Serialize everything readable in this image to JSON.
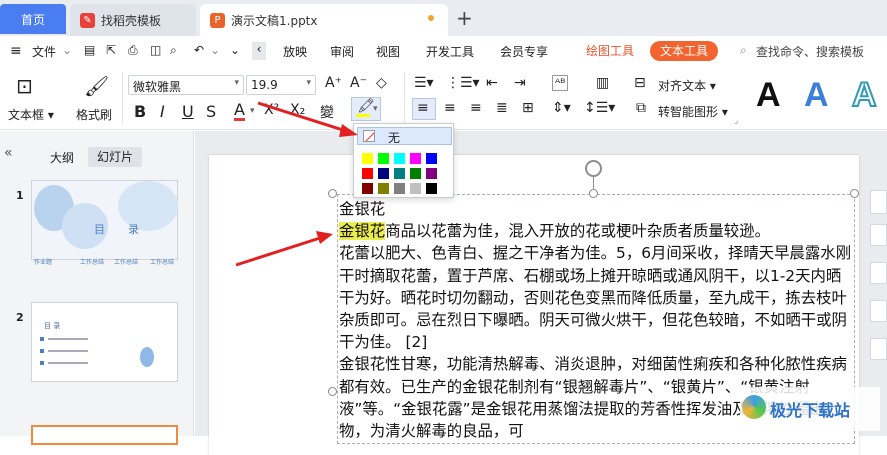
{
  "tabs": {
    "home": "首页",
    "template": "找稻壳模板",
    "document": "演示文稿1.pptx",
    "new_tab": "+"
  },
  "menu": {
    "file": "文件",
    "items": [
      "放映",
      "审阅",
      "视图",
      "开发工具",
      "会员专享"
    ],
    "drawing_tools": "绘图工具",
    "text_tools": "文本工具",
    "search_placeholder": "查找命令、搜索模板"
  },
  "ribbon": {
    "textbox": "文本框",
    "format_painter": "格式刷",
    "font_name": "微软雅黑",
    "font_size": "19.9",
    "align_text": "对齐文本",
    "smart_shape": "转智能图形",
    "style_samples": [
      "A",
      "A",
      "A"
    ]
  },
  "left_panel": {
    "outline_tab": "大纲",
    "slides_tab": "幻灯片",
    "slide1_number": "1",
    "slide2_number": "2",
    "slide1_title_left": "目",
    "slide1_title_right": "录",
    "slide1_labels": [
      "作业题",
      "工作总结",
      "工作总结",
      "工作总结"
    ],
    "slide2_title": "目  录"
  },
  "highlight_popup": {
    "none_label": "无",
    "colors": [
      "#ffff00",
      "#00ff00",
      "#00ffff",
      "#ff00ff",
      "#0000ff",
      "#ff0000",
      "#000080",
      "#008080",
      "#008000",
      "#800080",
      "#800000",
      "#808000",
      "#808080",
      "#c0c0c0",
      "#000000"
    ]
  },
  "slide": {
    "title": "金银花",
    "highlighted": "金银花",
    "body_line1_rest": "商品以花蕾为佳，混入开放的花或梗叶杂质者质量较逊。",
    "body": "花蕾以肥大、色青白、握之干净者为佳。5，6月间采收，择晴天早晨露水刚干时摘取花蕾，置于芦席、石棚或场上摊开晾晒或通风阴干，以1-2天内晒干为好。晒花时切勿翻动，否则花色变黑而降低质量，至九成干，拣去枝叶杂质即可。忌在烈日下曝晒。阴天可微火烘干，但花色较暗，不如晒干或阴干为佳。 [2]\n金银花性甘寒，功能清热解毒、消炎退肿，对细菌性痢疾和各种化脓性疾病都有效。已生产的金银花制剂有“银翘解毒片”、“银黄片”、“银黄注射液”等。“金银花露”是金银花用蒸馏法提取的芳香性挥发油及水溶性溜出物，为清火解毒的良品，可"
  },
  "watermark": "极光下载站"
}
